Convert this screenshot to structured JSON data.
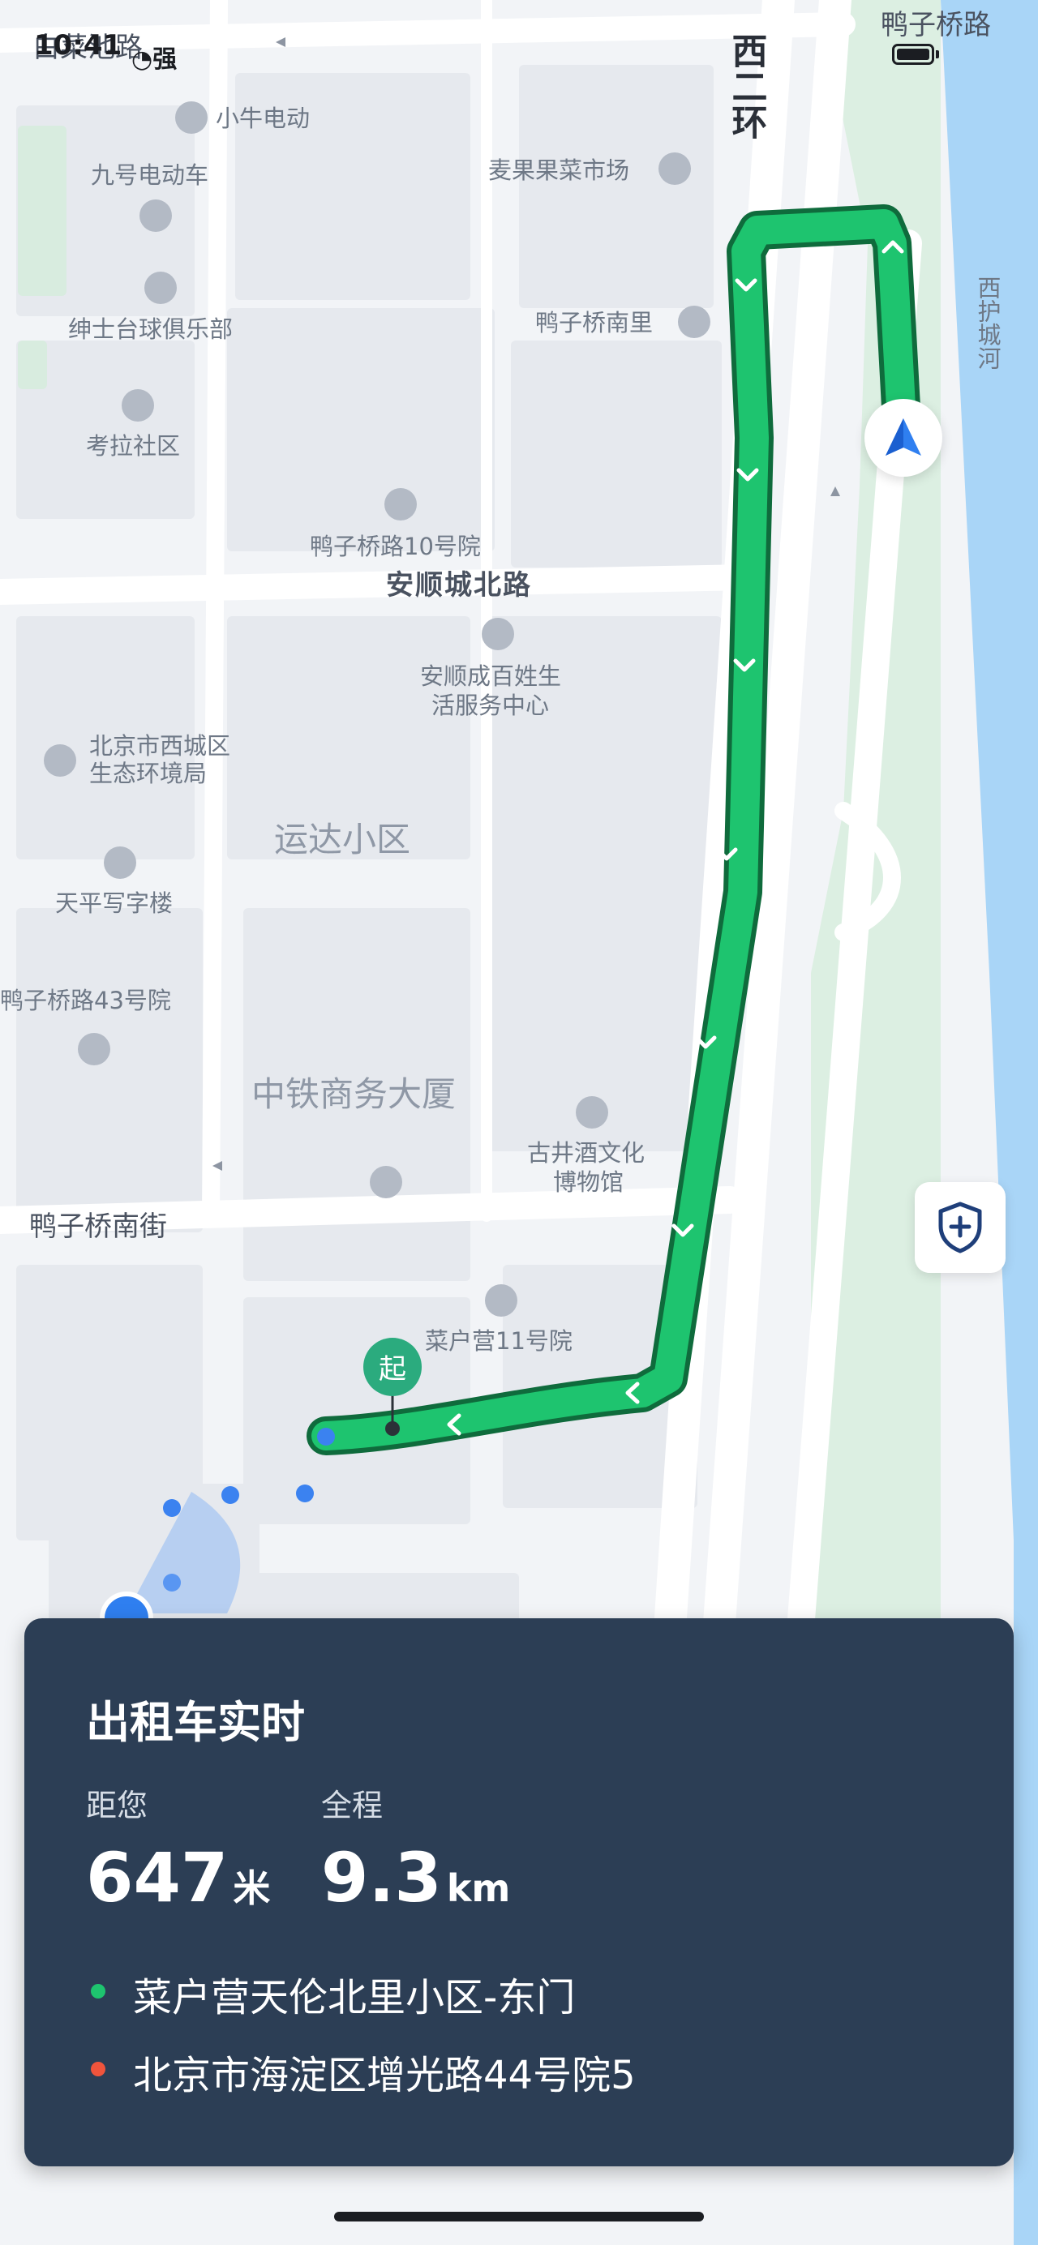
{
  "status_bar": {
    "time": "10:41",
    "signal_label": "强"
  },
  "map": {
    "roads": {
      "west_second_ring": "西二环",
      "yazi_bridge_road": "鸭子桥路",
      "anshuncheng_north_road": "安顺城北路",
      "yazi_bridge_south_street": "鸭子桥南街",
      "top_left_road": "白菜池路",
      "moat": "西护城河"
    },
    "areas": {
      "yunda": "运达小区",
      "zhongtie": "中铁商务大厦"
    },
    "pois": [
      {
        "id": "xiaoniu",
        "label": "小牛电动",
        "icon": "lock-icon"
      },
      {
        "id": "jiuhao",
        "label": "九号电动车",
        "icon": "lock-icon"
      },
      {
        "id": "shenshi",
        "label": "绅士台球俱乐部",
        "icon": "billiards-icon"
      },
      {
        "id": "kaola",
        "label": "考拉社区",
        "icon": "residential-icon"
      },
      {
        "id": "maiguo",
        "label": "麦果果菜市场",
        "icon": "lock-icon"
      },
      {
        "id": "yazinanli",
        "label": "鸭子桥南里",
        "icon": "residential-icon"
      },
      {
        "id": "yazi10",
        "label": "鸭子桥路10号院",
        "icon": "residential-icon"
      },
      {
        "id": "anshun1",
        "label": "安顺成百姓生",
        "icon": "lock-icon"
      },
      {
        "id": "anshun2",
        "label": "活服务中心",
        "icon": ""
      },
      {
        "id": "xicheng1",
        "label": "北京市西城区",
        "icon": "star-icon"
      },
      {
        "id": "xicheng2",
        "label": "生态环境局",
        "icon": ""
      },
      {
        "id": "tianping",
        "label": "天平写字楼",
        "icon": "office-icon"
      },
      {
        "id": "yazi43",
        "label": "鸭子桥路43号院",
        "icon": "residential-icon"
      },
      {
        "id": "gujing1",
        "label": "古井酒文化",
        "icon": "museum-icon"
      },
      {
        "id": "gujing2",
        "label": "博物馆",
        "icon": ""
      },
      {
        "id": "caihu11",
        "label": "菜户营11号院",
        "icon": "residential-icon"
      }
    ],
    "start_marker_label": "起",
    "colors": {
      "route": "#1ec46f",
      "route_outline": "#0f6b3c",
      "location": "#2f7ff0"
    }
  },
  "buttons": {
    "safety": {
      "icon": "shield-plus-icon"
    },
    "locate": {
      "icon": "navigation-arrow-icon"
    }
  },
  "trip_card": {
    "title": "出租车实时",
    "distance_label": "距您",
    "distance_value": "647",
    "distance_unit": "米",
    "total_label": "全程",
    "total_value": "9.3",
    "total_unit": "km",
    "origin": "菜户营天伦北里小区-东门",
    "destination": "北京市海淀区增光路44号院5",
    "colors": {
      "background": "#2c3e55",
      "origin_dot": "#1ec46f",
      "destination_dot": "#f0543c"
    }
  }
}
